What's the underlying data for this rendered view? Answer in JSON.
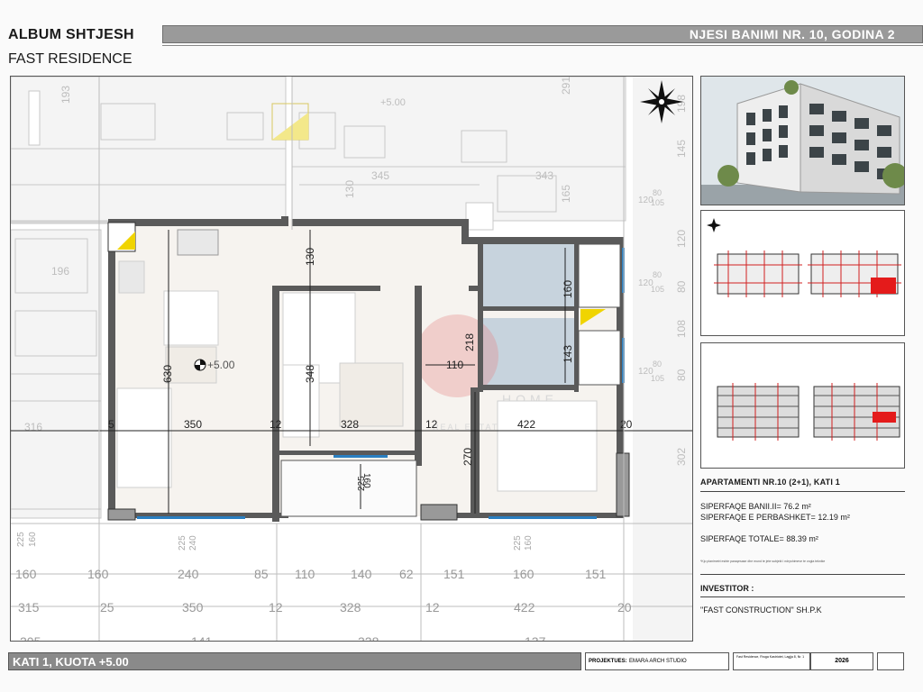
{
  "header": {
    "album_title": "ALBUM SHTJESH",
    "project_name": "FAST RESIDENCE",
    "unit_title": "NJESI BANIMI NR. 10, GODINA 2"
  },
  "plan": {
    "dims_top_inner": [
      "5",
      "350",
      "12",
      "328",
      "12",
      "422",
      "20"
    ],
    "dims_bottom_row1": [
      "160",
      "160",
      "240",
      "85",
      "110",
      "140",
      "62",
      "151",
      "160",
      "151"
    ],
    "dims_bottom_row2": [
      "315",
      "25",
      "350",
      "12",
      "328",
      "12",
      "422",
      "20"
    ],
    "dims_bottom_row3": [
      "205",
      "141",
      "328",
      "137"
    ],
    "dims_vertical": {
      "d630": "630",
      "d130": "130",
      "d348": "348",
      "d218": "218",
      "d270": "270",
      "d160": "160",
      "d143": "143",
      "d110": "110",
      "d225": "225",
      "d160b": "160"
    },
    "dims_right": [
      "145",
      "120",
      "80",
      "105",
      "120",
      "80",
      "105",
      "120",
      "80",
      "105",
      "108",
      "80",
      "120",
      "302",
      "291",
      "198"
    ],
    "dims_left_misc": [
      "193",
      "196",
      "316",
      "345",
      "343",
      "130",
      "165",
      "225",
      "160",
      "240",
      "225",
      "160",
      "225"
    ],
    "level_marker": "+5.00",
    "level_marker_top": "+5.00",
    "watermark_left": "GO",
    "watermark_right": "HOME",
    "watermark_mid": "REAL ESTATE"
  },
  "apartment": {
    "title": "APARTAMENTI NR.10 (2+1), KATI 1",
    "area_usable_label": "SIPERFAQE BANII.II=",
    "area_usable_value": "76.2 m²",
    "area_common_label": "SIPERFAQE E PERBASHKET=",
    "area_common_value": "12.19 m²",
    "area_total_label": "SIPERFAQE TOTALE=",
    "area_total_value": "88.39 m²",
    "note": "*Kjo planimetri eshte paraqesase dhe mund te jete subjekt i ndryshimeve te vogla teknike"
  },
  "investor": {
    "label": "INVESTITOR :",
    "name": "\"FAST CONSTRUCTION\" SH.P.K"
  },
  "footer": {
    "floor_label": "KATI 1, KUOTA +5.00",
    "designer_label": "PROJEKTUES:",
    "designer_name": "EMARA ARCH STUDIO",
    "year": "2026",
    "small_text": "Fast Residence, Rruga Kastriotet, Lagjja 8, Nr. 1"
  },
  "colors": {
    "wall": "#555555",
    "wall_cut": "#7a7a7a",
    "bath_fill": "#c7d3dd",
    "logo_red": "#e58a8a",
    "window": "#2a7fc1",
    "faded": "#bfbfbf",
    "accent_yellow": "#f0d400",
    "red_marks": "#d12020"
  },
  "icons": {
    "compass": "north-compass-icon",
    "level": "level-marker-icon"
  }
}
